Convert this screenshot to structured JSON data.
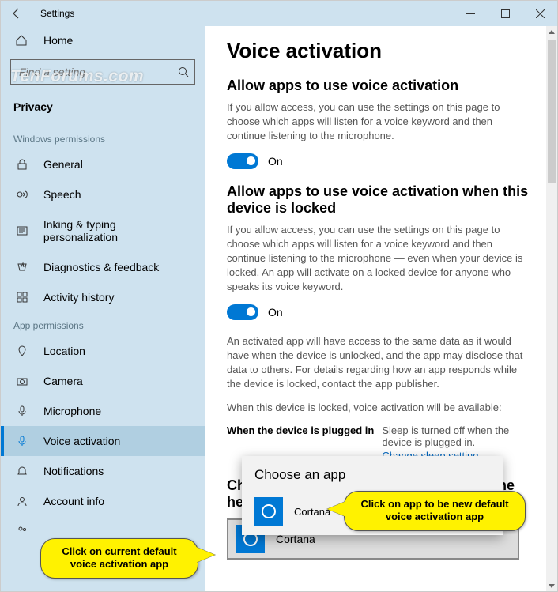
{
  "titlebar": {
    "title": "Settings"
  },
  "watermark": "TenForums.com",
  "sidebar": {
    "home": "Home",
    "search_placeholder": "Find a setting",
    "category": "Privacy",
    "group_win": "Windows permissions",
    "group_app": "App permissions",
    "win_items": [
      "General",
      "Speech",
      "Inking & typing personalization",
      "Diagnostics & feedback",
      "Activity history"
    ],
    "app_items": [
      "Location",
      "Camera",
      "Microphone",
      "Voice activation",
      "Notifications",
      "Account info"
    ]
  },
  "content": {
    "h1": "Voice activation",
    "s1_title": "Allow apps to use voice activation",
    "s1_desc": "If you allow access, you can use the settings on this page to choose which apps will listen for a voice keyword and then continue listening to the microphone.",
    "s1_toggle": "On",
    "s2_title": "Allow apps to use voice activation when this device is locked",
    "s2_desc": "If you allow access, you can use the settings on this page to choose which apps will listen for a voice keyword and then continue listening to the microphone — even when your device is locked. An app will activate on a locked device for anyone who speaks its voice keyword.",
    "s2_toggle": "On",
    "s2_note": "An activated app will have access to the same data as it would have when the device is unlocked, and the app may disclose that data to others. For details regarding how an app responds while the device is locked, contact the app publisher.",
    "s2_avail": "When this device is locked, voice activation will be available:",
    "plug_label": "When the device is plugged in",
    "plug_desc": "Sleep is turned off when the device is plugged in.",
    "plug_link": "Change sleep setting",
    "s3_title": "Choose what happens when you press the headset butto",
    "selected_app": "Cortana",
    "popup_title": "Choose an app",
    "popup_item": "Cortana"
  },
  "callouts": {
    "c1": "Click on current default voice activation app",
    "c2": "Click on app to be new default voice activation app"
  }
}
